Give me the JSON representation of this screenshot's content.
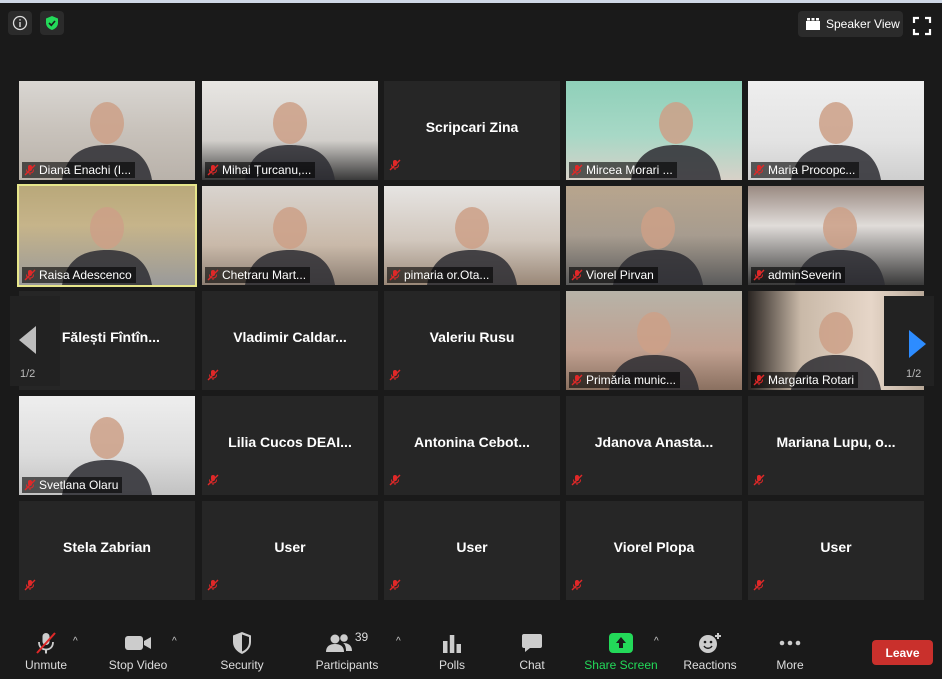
{
  "topbar": {
    "speaker_view": "Speaker View"
  },
  "nav": {
    "page_left": "1/2",
    "page_right": "1/2"
  },
  "tiles": [
    {
      "name": "Diana Enachi (I...",
      "type": "video"
    },
    {
      "name": "Mihai Țurcanu,...",
      "type": "video"
    },
    {
      "name": "Scripcari Zina",
      "type": "name"
    },
    {
      "name": "Mircea Morari ...",
      "type": "video"
    },
    {
      "name": "Maria Procopc...",
      "type": "video"
    },
    {
      "name": "Raisa Adescenco",
      "type": "video",
      "active": true
    },
    {
      "name": "Chetraru Mart...",
      "type": "video"
    },
    {
      "name": "pimaria or.Ota...",
      "type": "video"
    },
    {
      "name": "Viorel Pirvan",
      "type": "video"
    },
    {
      "name": "adminSeverin",
      "type": "video"
    },
    {
      "name": ". Fălești Fîntîn...",
      "type": "name"
    },
    {
      "name": "Vladimir  Caldar...",
      "type": "name"
    },
    {
      "name": "Valeriu Rusu",
      "type": "name"
    },
    {
      "name": "Primăria munic...",
      "type": "video"
    },
    {
      "name": "Margarita Rotari",
      "type": "video"
    },
    {
      "name": "Svetlana Olaru",
      "type": "video"
    },
    {
      "name": "Lilia  Cucos  DEAI...",
      "type": "name"
    },
    {
      "name": "Antonina  Cebot...",
      "type": "name"
    },
    {
      "name": "Jdanova  Anasta...",
      "type": "name"
    },
    {
      "name": "Mariana  Lupu,  o...",
      "type": "name"
    },
    {
      "name": "Stela Zabrian",
      "type": "name"
    },
    {
      "name": "User",
      "type": "name"
    },
    {
      "name": "User",
      "type": "name"
    },
    {
      "name": "Viorel Plopa",
      "type": "name"
    },
    {
      "name": "User",
      "type": "name"
    }
  ],
  "toolbar": {
    "unmute": "Unmute",
    "stop_video": "Stop Video",
    "security": "Security",
    "participants": "Participants",
    "participants_count": "39",
    "polls": "Polls",
    "chat": "Chat",
    "share_screen": "Share Screen",
    "reactions": "Reactions",
    "more": "More",
    "leave": "Leave"
  },
  "colors": {
    "share_green": "#23d959",
    "leave_red": "#c9302c",
    "active_border": "#e7e68b",
    "muted_red": "#e02828",
    "nav_arrow_blue": "#2d8cff"
  }
}
